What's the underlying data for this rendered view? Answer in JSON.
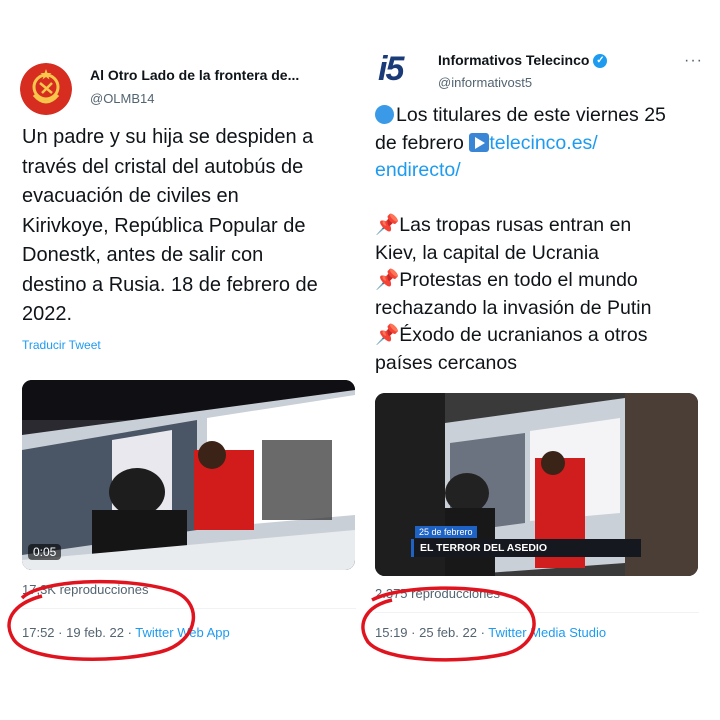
{
  "left_tweet": {
    "display_name": "Al Otro Lado de la frontera de...",
    "handle": "@OLMB14",
    "text_lines": [
      "Un padre y su hija se despiden a",
      "través del cristal del autobús de",
      "evacuación de civiles en",
      "Kirivkoye, República Popular de",
      "Donestk, antes de salir con",
      "destino a Rusia. 18 de febrero de",
      "2022."
    ],
    "translate_label": "Traducir Tweet",
    "video_time": "0:05",
    "views": "17,3K reproducciones",
    "time": "17:52",
    "date": "19 feb. 22",
    "source": "Twitter Web App",
    "avatar_icon": "soviet-emblem-icon"
  },
  "right_tweet": {
    "display_name": "Informativos Telecinco",
    "handle": "@informativost5",
    "logo_text": "i5",
    "line1_pre": "Los titulares de este viernes 25",
    "line2_pre": "de febrero ",
    "line2_link": "telecinco.es/",
    "line3_link": "endirecto/",
    "bullet1_a": "Las tropas rusas entran en",
    "bullet1_b": "Kiev, la capital de Ucrania",
    "bullet2_a": "Protestas en todo el mundo",
    "bullet2_b": "rechazando la invasión de Putin",
    "bullet3_a": "Éxodo de ucranianos a otros",
    "bullet3_b": "países cercanos",
    "video_date_label": "25 de febrero",
    "video_headline": "EL TERROR DEL ASEDIO",
    "views": "2.375 reproducciones",
    "time": "15:19",
    "date": "25 feb. 22",
    "source": "Twitter Media Studio",
    "more_label": "···",
    "icons": [
      "blue-circle-emoji-icon",
      "play-button-emoji-icon",
      "pushpin-emoji-icon",
      "verified-badge-icon"
    ]
  },
  "colors": {
    "link": "#1d9bf0",
    "annotation": "#e0141e",
    "muted": "#536471"
  }
}
